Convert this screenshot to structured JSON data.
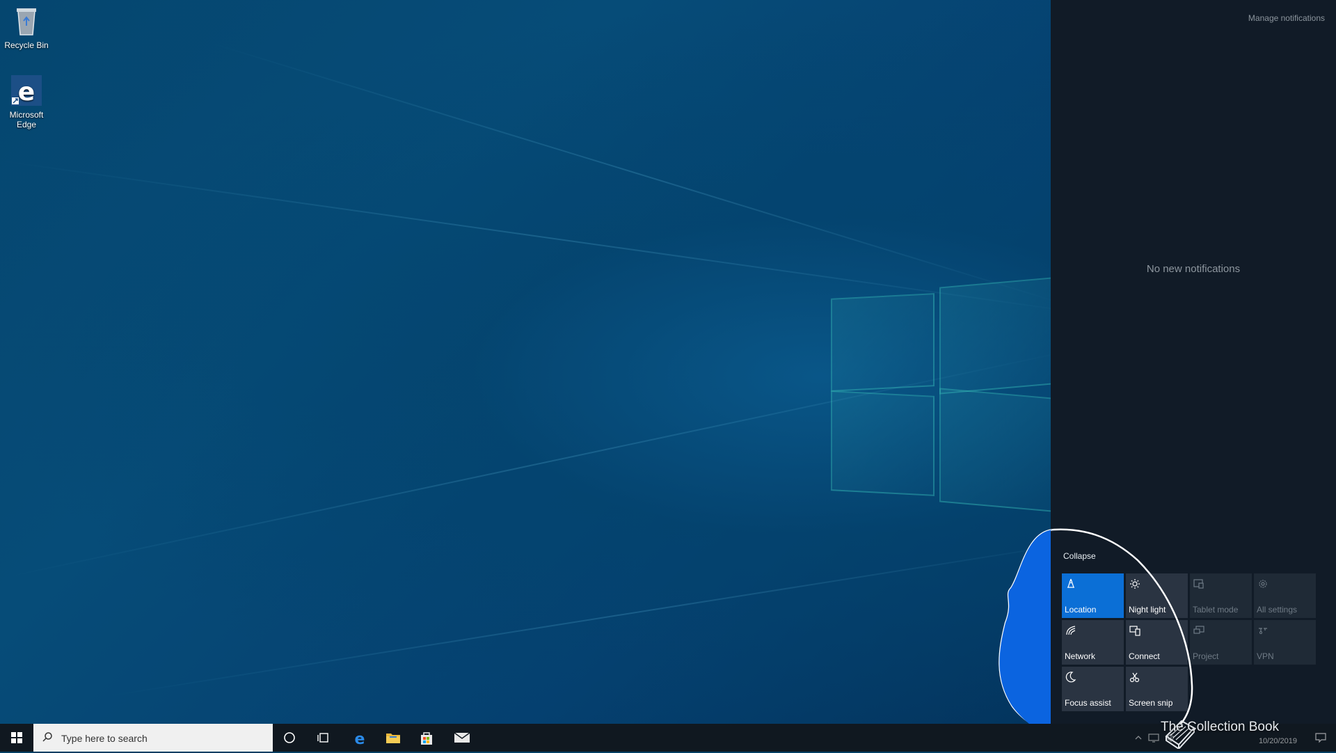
{
  "desktop": {
    "icons": [
      {
        "label": "Recycle Bin"
      },
      {
        "label": "Microsoft Edge"
      }
    ]
  },
  "action_center": {
    "manage_label": "Manage notifications",
    "empty_text": "No new notifications",
    "collapse_label": "Collapse",
    "tiles": [
      {
        "label": "Location",
        "icon": "location-icon",
        "state": "on"
      },
      {
        "label": "Night light",
        "icon": "night-light-icon",
        "state": "off"
      },
      {
        "label": "Tablet mode",
        "icon": "tablet-mode-icon",
        "state": "disabled"
      },
      {
        "label": "All settings",
        "icon": "gear-icon",
        "state": "disabled"
      },
      {
        "label": "Network",
        "icon": "network-icon",
        "state": "off"
      },
      {
        "label": "Connect",
        "icon": "connect-icon",
        "state": "off"
      },
      {
        "label": "Project",
        "icon": "project-icon",
        "state": "disabled"
      },
      {
        "label": "VPN",
        "icon": "vpn-icon",
        "state": "disabled"
      },
      {
        "label": "Focus assist",
        "icon": "moon-icon",
        "state": "off"
      },
      {
        "label": "Screen snip",
        "icon": "scissors-icon",
        "state": "off"
      }
    ],
    "accent_color": "#0b6fd6"
  },
  "taskbar": {
    "search_placeholder": "Type here to search",
    "clock_date": "10/20/2019"
  },
  "watermark": {
    "text": "The Collection Book"
  }
}
